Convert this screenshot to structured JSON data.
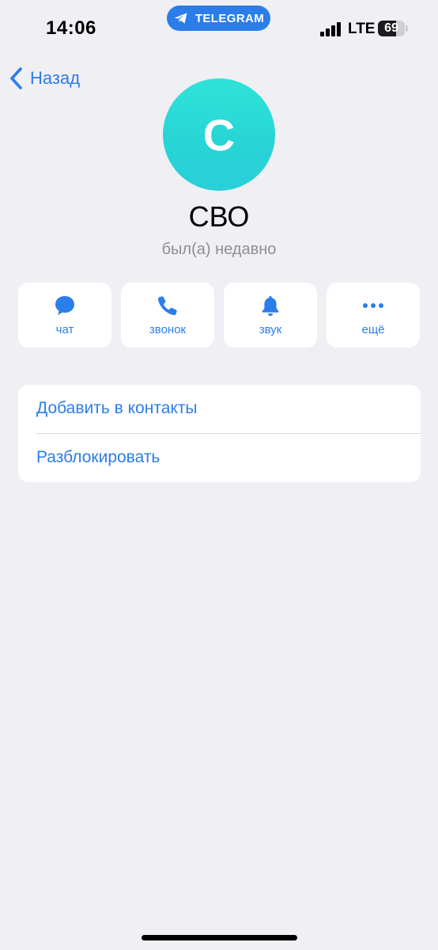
{
  "status_bar": {
    "time": "14:06",
    "app_pill": {
      "label": "TELEGRAM",
      "icon": "telegram-plane-icon",
      "color": "#2b7de9"
    },
    "network": "LTE",
    "signal_bars": 4,
    "battery_percent": 69
  },
  "nav": {
    "back_label": "Назад",
    "back_icon": "chevron-left-icon"
  },
  "profile": {
    "avatar_letter": "С",
    "avatar_color": "#2ed8d8",
    "name": "СВО",
    "last_seen": "был(а) недавно"
  },
  "actions": [
    {
      "label": "чат",
      "icon": "chat-bubble-icon"
    },
    {
      "label": "звонок",
      "icon": "phone-icon"
    },
    {
      "label": "звук",
      "icon": "bell-icon"
    },
    {
      "label": "ещё",
      "icon": "more-dots-icon"
    }
  ],
  "menu": [
    {
      "label": "Добавить в контакты"
    },
    {
      "label": "Разблокировать"
    }
  ],
  "accent_color": "#2b7de9"
}
